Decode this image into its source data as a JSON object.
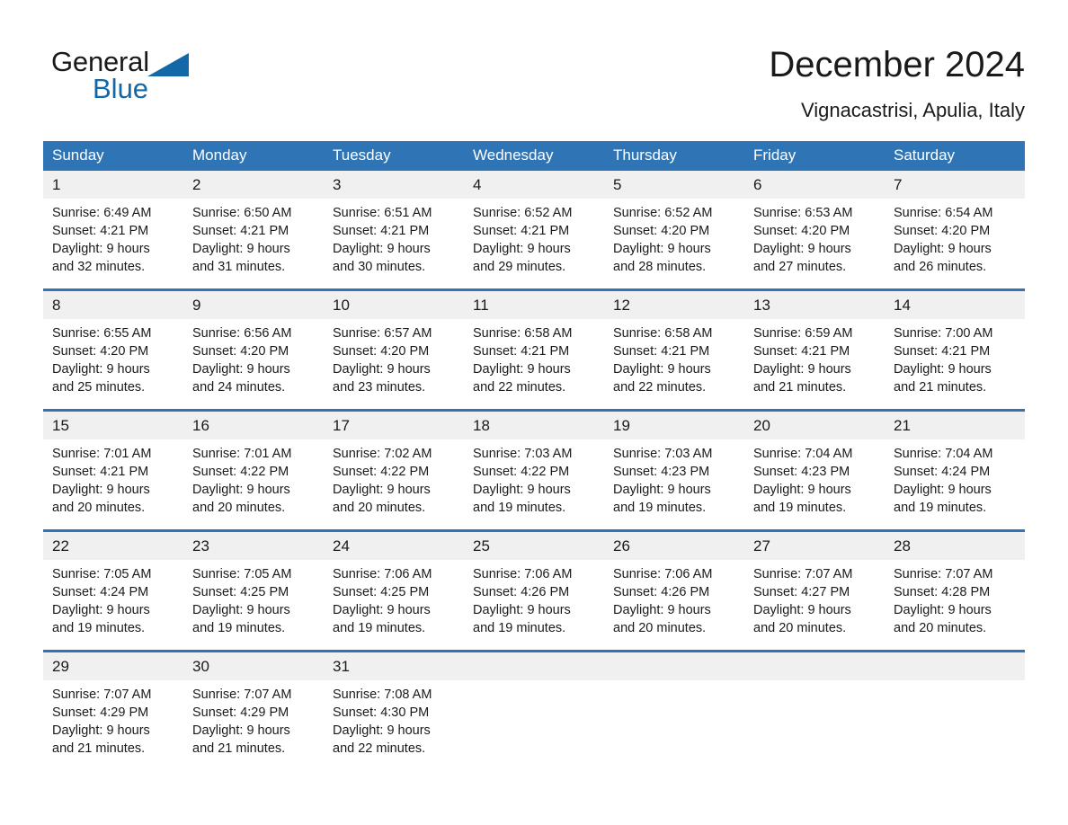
{
  "brand": {
    "name_part1": "General",
    "name_part2": "Blue",
    "triangle_icon": "brand-triangle-icon",
    "colors": {
      "blue": "#1368a8",
      "black": "#1a1a1a"
    }
  },
  "header": {
    "title": "December 2024",
    "location": "Vignacastrisi, Apulia, Italy"
  },
  "theme": {
    "header_blue": "#2f75b5",
    "day_band_gray": "#f0f0f0",
    "text": "#1a1a1a",
    "cell_bg": "#ffffff"
  },
  "weekdays": [
    {
      "label": "Sunday"
    },
    {
      "label": "Monday"
    },
    {
      "label": "Tuesday"
    },
    {
      "label": "Wednesday"
    },
    {
      "label": "Thursday"
    },
    {
      "label": "Friday"
    },
    {
      "label": "Saturday"
    }
  ],
  "weeks": [
    {
      "days": [
        {
          "num": "1",
          "sunrise": "Sunrise: 6:49 AM",
          "sunset": "Sunset: 4:21 PM",
          "daylight1": "Daylight: 9 hours",
          "daylight2": "and 32 minutes."
        },
        {
          "num": "2",
          "sunrise": "Sunrise: 6:50 AM",
          "sunset": "Sunset: 4:21 PM",
          "daylight1": "Daylight: 9 hours",
          "daylight2": "and 31 minutes."
        },
        {
          "num": "3",
          "sunrise": "Sunrise: 6:51 AM",
          "sunset": "Sunset: 4:21 PM",
          "daylight1": "Daylight: 9 hours",
          "daylight2": "and 30 minutes."
        },
        {
          "num": "4",
          "sunrise": "Sunrise: 6:52 AM",
          "sunset": "Sunset: 4:21 PM",
          "daylight1": "Daylight: 9 hours",
          "daylight2": "and 29 minutes."
        },
        {
          "num": "5",
          "sunrise": "Sunrise: 6:52 AM",
          "sunset": "Sunset: 4:20 PM",
          "daylight1": "Daylight: 9 hours",
          "daylight2": "and 28 minutes."
        },
        {
          "num": "6",
          "sunrise": "Sunrise: 6:53 AM",
          "sunset": "Sunset: 4:20 PM",
          "daylight1": "Daylight: 9 hours",
          "daylight2": "and 27 minutes."
        },
        {
          "num": "7",
          "sunrise": "Sunrise: 6:54 AM",
          "sunset": "Sunset: 4:20 PM",
          "daylight1": "Daylight: 9 hours",
          "daylight2": "and 26 minutes."
        }
      ]
    },
    {
      "days": [
        {
          "num": "8",
          "sunrise": "Sunrise: 6:55 AM",
          "sunset": "Sunset: 4:20 PM",
          "daylight1": "Daylight: 9 hours",
          "daylight2": "and 25 minutes."
        },
        {
          "num": "9",
          "sunrise": "Sunrise: 6:56 AM",
          "sunset": "Sunset: 4:20 PM",
          "daylight1": "Daylight: 9 hours",
          "daylight2": "and 24 minutes."
        },
        {
          "num": "10",
          "sunrise": "Sunrise: 6:57 AM",
          "sunset": "Sunset: 4:20 PM",
          "daylight1": "Daylight: 9 hours",
          "daylight2": "and 23 minutes."
        },
        {
          "num": "11",
          "sunrise": "Sunrise: 6:58 AM",
          "sunset": "Sunset: 4:21 PM",
          "daylight1": "Daylight: 9 hours",
          "daylight2": "and 22 minutes."
        },
        {
          "num": "12",
          "sunrise": "Sunrise: 6:58 AM",
          "sunset": "Sunset: 4:21 PM",
          "daylight1": "Daylight: 9 hours",
          "daylight2": "and 22 minutes."
        },
        {
          "num": "13",
          "sunrise": "Sunrise: 6:59 AM",
          "sunset": "Sunset: 4:21 PM",
          "daylight1": "Daylight: 9 hours",
          "daylight2": "and 21 minutes."
        },
        {
          "num": "14",
          "sunrise": "Sunrise: 7:00 AM",
          "sunset": "Sunset: 4:21 PM",
          "daylight1": "Daylight: 9 hours",
          "daylight2": "and 21 minutes."
        }
      ]
    },
    {
      "days": [
        {
          "num": "15",
          "sunrise": "Sunrise: 7:01 AM",
          "sunset": "Sunset: 4:21 PM",
          "daylight1": "Daylight: 9 hours",
          "daylight2": "and 20 minutes."
        },
        {
          "num": "16",
          "sunrise": "Sunrise: 7:01 AM",
          "sunset": "Sunset: 4:22 PM",
          "daylight1": "Daylight: 9 hours",
          "daylight2": "and 20 minutes."
        },
        {
          "num": "17",
          "sunrise": "Sunrise: 7:02 AM",
          "sunset": "Sunset: 4:22 PM",
          "daylight1": "Daylight: 9 hours",
          "daylight2": "and 20 minutes."
        },
        {
          "num": "18",
          "sunrise": "Sunrise: 7:03 AM",
          "sunset": "Sunset: 4:22 PM",
          "daylight1": "Daylight: 9 hours",
          "daylight2": "and 19 minutes."
        },
        {
          "num": "19",
          "sunrise": "Sunrise: 7:03 AM",
          "sunset": "Sunset: 4:23 PM",
          "daylight1": "Daylight: 9 hours",
          "daylight2": "and 19 minutes."
        },
        {
          "num": "20",
          "sunrise": "Sunrise: 7:04 AM",
          "sunset": "Sunset: 4:23 PM",
          "daylight1": "Daylight: 9 hours",
          "daylight2": "and 19 minutes."
        },
        {
          "num": "21",
          "sunrise": "Sunrise: 7:04 AM",
          "sunset": "Sunset: 4:24 PM",
          "daylight1": "Daylight: 9 hours",
          "daylight2": "and 19 minutes."
        }
      ]
    },
    {
      "days": [
        {
          "num": "22",
          "sunrise": "Sunrise: 7:05 AM",
          "sunset": "Sunset: 4:24 PM",
          "daylight1": "Daylight: 9 hours",
          "daylight2": "and 19 minutes."
        },
        {
          "num": "23",
          "sunrise": "Sunrise: 7:05 AM",
          "sunset": "Sunset: 4:25 PM",
          "daylight1": "Daylight: 9 hours",
          "daylight2": "and 19 minutes."
        },
        {
          "num": "24",
          "sunrise": "Sunrise: 7:06 AM",
          "sunset": "Sunset: 4:25 PM",
          "daylight1": "Daylight: 9 hours",
          "daylight2": "and 19 minutes."
        },
        {
          "num": "25",
          "sunrise": "Sunrise: 7:06 AM",
          "sunset": "Sunset: 4:26 PM",
          "daylight1": "Daylight: 9 hours",
          "daylight2": "and 19 minutes."
        },
        {
          "num": "26",
          "sunrise": "Sunrise: 7:06 AM",
          "sunset": "Sunset: 4:26 PM",
          "daylight1": "Daylight: 9 hours",
          "daylight2": "and 20 minutes."
        },
        {
          "num": "27",
          "sunrise": "Sunrise: 7:07 AM",
          "sunset": "Sunset: 4:27 PM",
          "daylight1": "Daylight: 9 hours",
          "daylight2": "and 20 minutes."
        },
        {
          "num": "28",
          "sunrise": "Sunrise: 7:07 AM",
          "sunset": "Sunset: 4:28 PM",
          "daylight1": "Daylight: 9 hours",
          "daylight2": "and 20 minutes."
        }
      ]
    },
    {
      "days": [
        {
          "num": "29",
          "sunrise": "Sunrise: 7:07 AM",
          "sunset": "Sunset: 4:29 PM",
          "daylight1": "Daylight: 9 hours",
          "daylight2": "and 21 minutes."
        },
        {
          "num": "30",
          "sunrise": "Sunrise: 7:07 AM",
          "sunset": "Sunset: 4:29 PM",
          "daylight1": "Daylight: 9 hours",
          "daylight2": "and 21 minutes."
        },
        {
          "num": "31",
          "sunrise": "Sunrise: 7:08 AM",
          "sunset": "Sunset: 4:30 PM",
          "daylight1": "Daylight: 9 hours",
          "daylight2": "and 22 minutes."
        },
        {
          "num": "",
          "sunrise": "",
          "sunset": "",
          "daylight1": "",
          "daylight2": ""
        },
        {
          "num": "",
          "sunrise": "",
          "sunset": "",
          "daylight1": "",
          "daylight2": ""
        },
        {
          "num": "",
          "sunrise": "",
          "sunset": "",
          "daylight1": "",
          "daylight2": ""
        },
        {
          "num": "",
          "sunrise": "",
          "sunset": "",
          "daylight1": "",
          "daylight2": ""
        }
      ]
    }
  ]
}
